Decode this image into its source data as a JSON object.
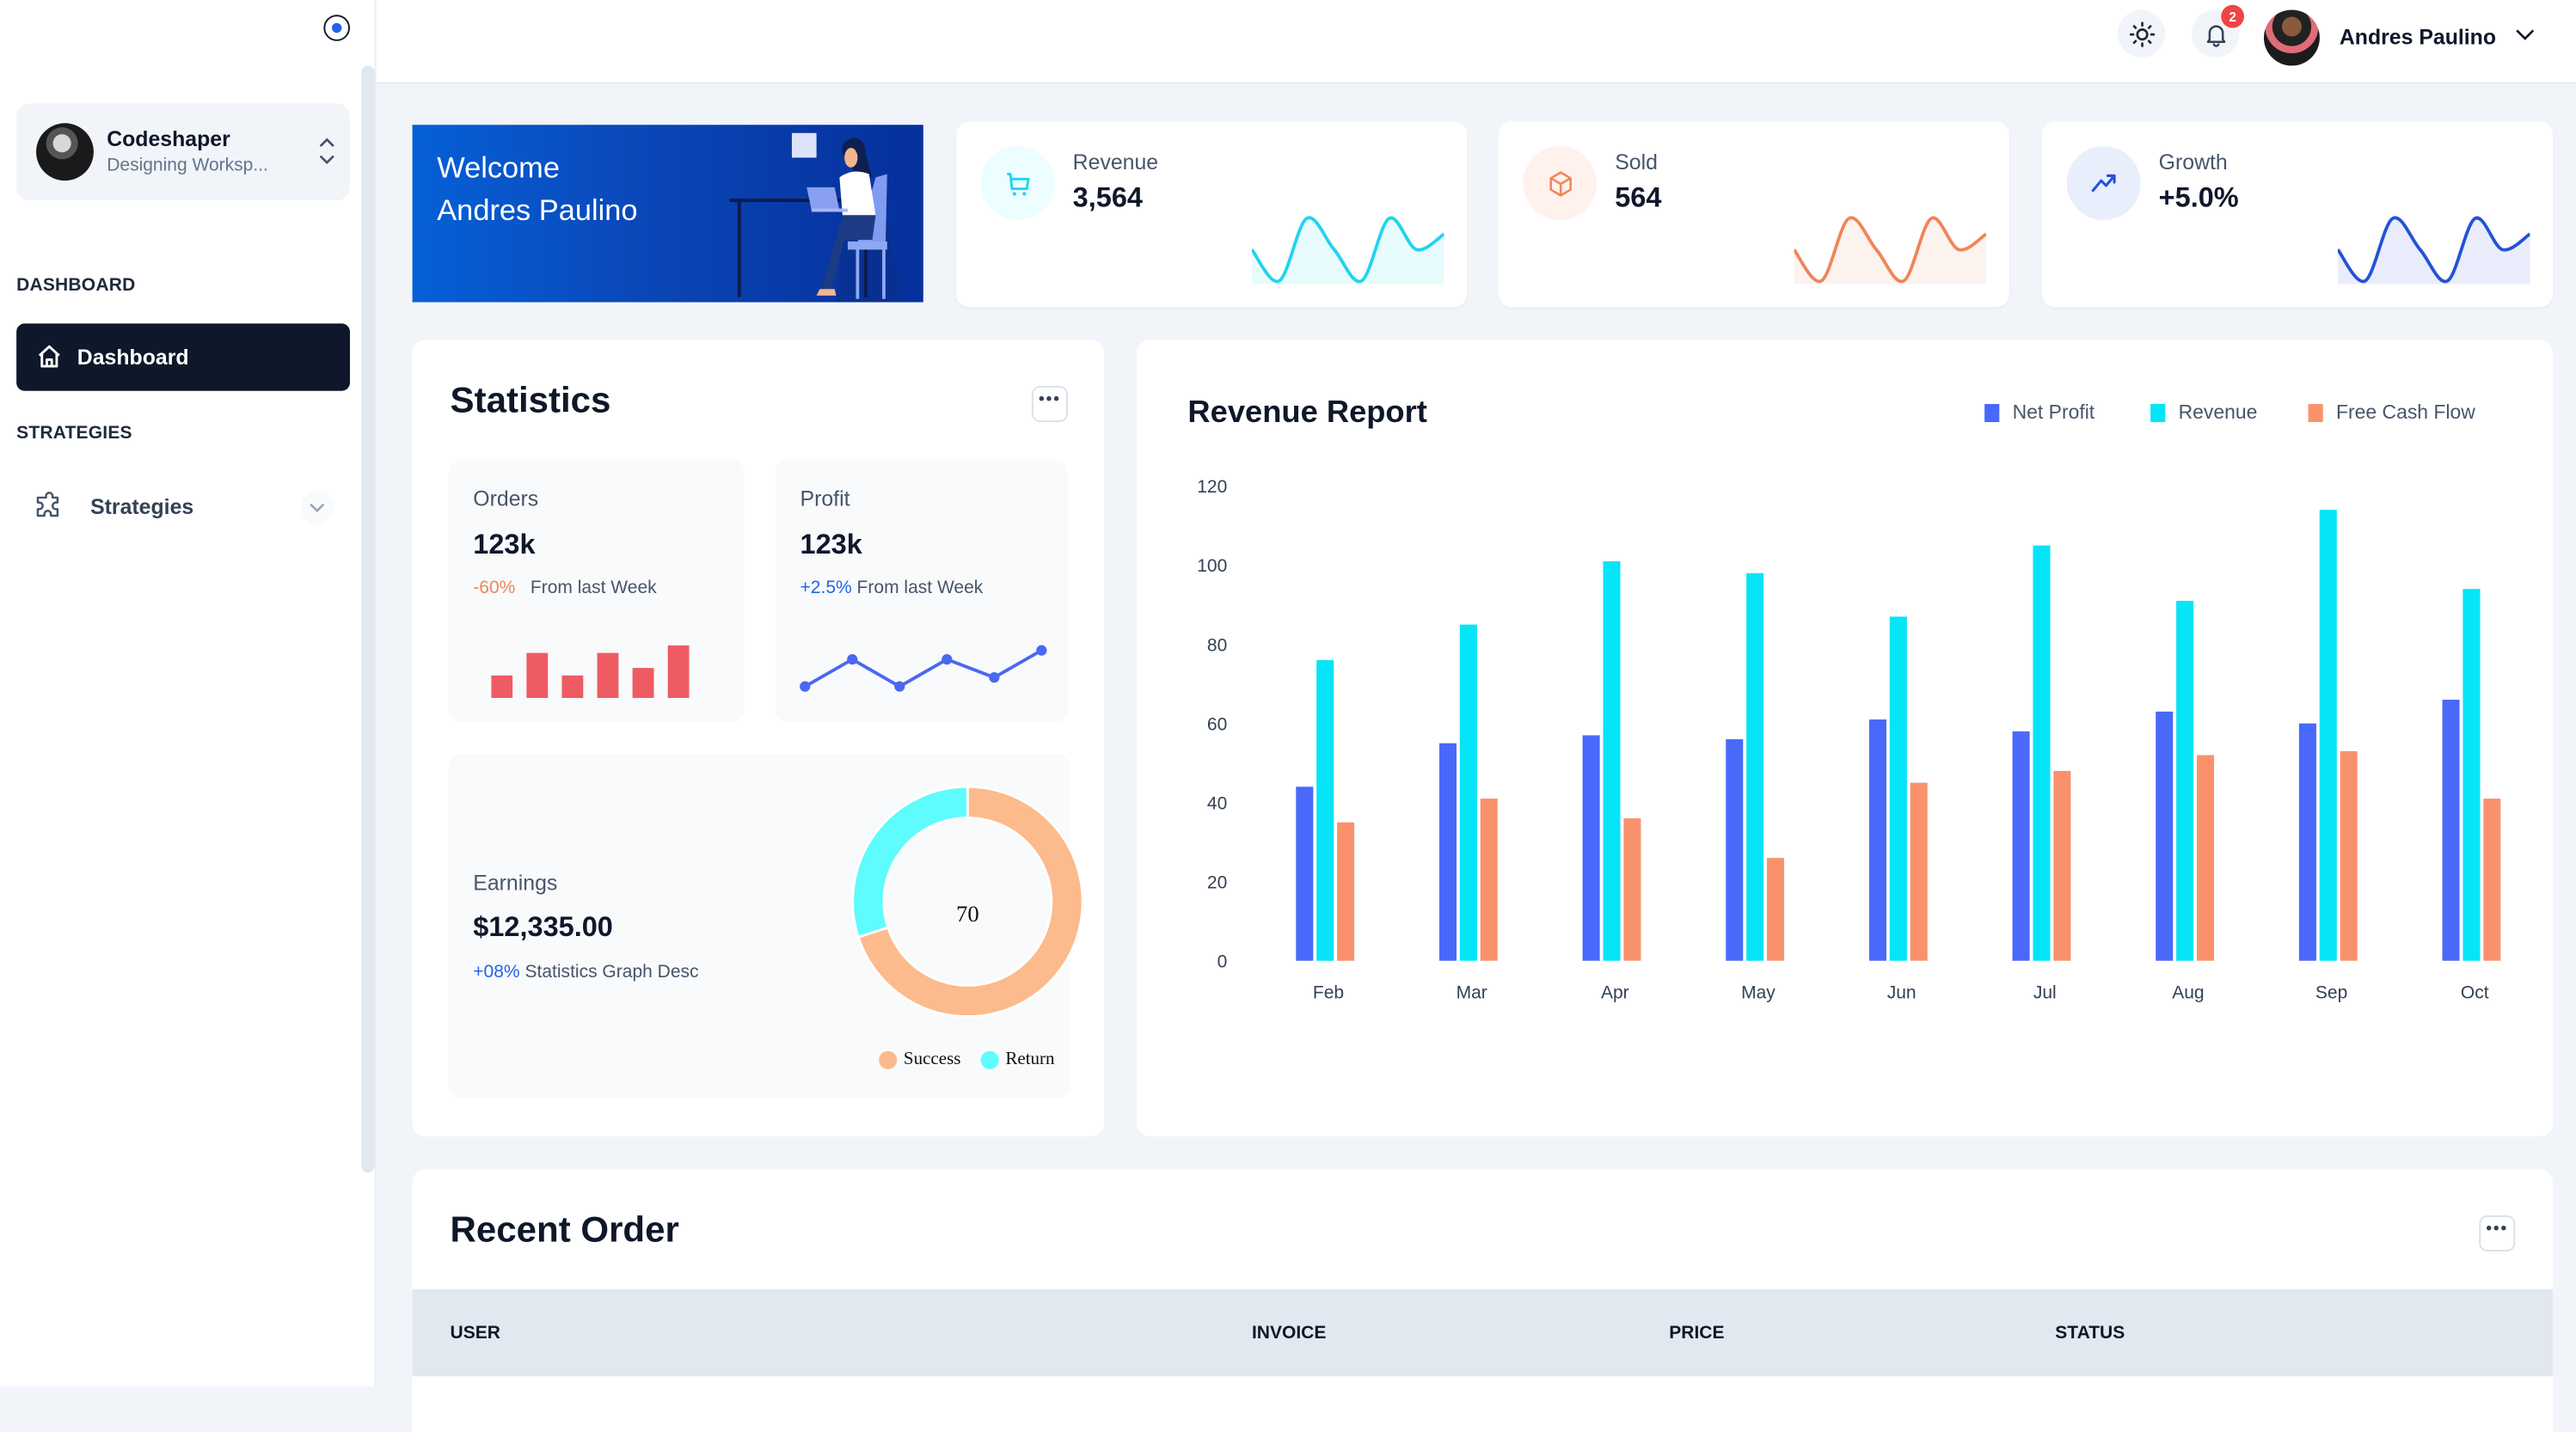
{
  "sidebar": {
    "workspace": {
      "name": "Codeshaper",
      "subtitle": "Designing Worksp..."
    },
    "sections": [
      {
        "heading": "DASHBOARD",
        "items": [
          {
            "label": "Dashboard",
            "icon": "home-icon",
            "active": true
          }
        ]
      },
      {
        "heading": "STRATEGIES",
        "items": [
          {
            "label": "Strategies",
            "icon": "puzzle-icon",
            "active": false
          }
        ]
      }
    ]
  },
  "header": {
    "theme_icon": "sun-icon",
    "notification_icon": "bell-icon",
    "notification_count": "2",
    "user_name": "Andres Paulino"
  },
  "welcome": {
    "line1": "Welcome",
    "line2": "Andres Paulino"
  },
  "stats": [
    {
      "label": "Revenue",
      "value": "3,564",
      "icon": "cart-icon",
      "color": "#22d3ee",
      "bg": "#ecfeff",
      "spark": [
        50,
        0,
        100,
        50,
        0,
        100,
        50,
        75
      ]
    },
    {
      "label": "Sold",
      "value": "564",
      "icon": "box-icon",
      "color": "#f0855a",
      "bg": "#fff1ec",
      "spark": [
        50,
        0,
        100,
        50,
        0,
        100,
        50,
        75
      ]
    },
    {
      "label": "Growth",
      "value": "+5.0%",
      "icon": "trending-up-icon",
      "color": "#2452d6",
      "bg": "#e8eefc",
      "spark": [
        50,
        0,
        100,
        50,
        0,
        100,
        50,
        75
      ]
    }
  ],
  "statistics": {
    "title": "Statistics",
    "orders": {
      "label": "Orders",
      "value": "123k",
      "change": "-60%",
      "change_text": "From last Week",
      "bars": [
        30,
        60,
        30,
        60,
        40,
        70
      ],
      "color": "#ef5b62"
    },
    "profit": {
      "label": "Profit",
      "value": "123k",
      "change": "+2.5%",
      "change_text": "From last Week",
      "points": [
        10,
        40,
        10,
        40,
        20,
        50
      ],
      "color": "#4a68f0"
    },
    "earnings": {
      "label": "Earnings",
      "value": "$12,335.00",
      "change": "+08%",
      "change_text": "Statistics Graph Desc",
      "donut_center": "70",
      "segments": [
        {
          "name": "Success",
          "value": 70,
          "color": "#fdba8c"
        },
        {
          "name": "Return",
          "value": 30,
          "color": "#5efcfc"
        }
      ]
    }
  },
  "recent_order": {
    "title": "Recent Order",
    "columns": [
      "USER",
      "INVOICE",
      "PRICE",
      "STATUS"
    ]
  },
  "chart_data": {
    "type": "bar",
    "title": "Revenue Report",
    "categories": [
      "Feb",
      "Mar",
      "Apr",
      "May",
      "Jun",
      "Jul",
      "Aug",
      "Sep",
      "Oct"
    ],
    "series": [
      {
        "name": "Net Profit",
        "color": "#4a68f9",
        "values": [
          44,
          55,
          57,
          56,
          61,
          58,
          63,
          60,
          66
        ]
      },
      {
        "name": "Revenue",
        "color": "#06e4f8",
        "values": [
          76,
          85,
          101,
          98,
          87,
          105,
          91,
          114,
          94
        ]
      },
      {
        "name": "Free Cash Flow",
        "color": "#f9926c",
        "values": [
          35,
          41,
          36,
          26,
          45,
          48,
          52,
          53,
          41
        ]
      }
    ],
    "yticks": [
      "0",
      "20",
      "40",
      "60",
      "80",
      "100",
      "120"
    ],
    "ylim": [
      0,
      120
    ],
    "xlabel": "",
    "ylabel": "",
    "grid": false,
    "legend": "top-right"
  }
}
